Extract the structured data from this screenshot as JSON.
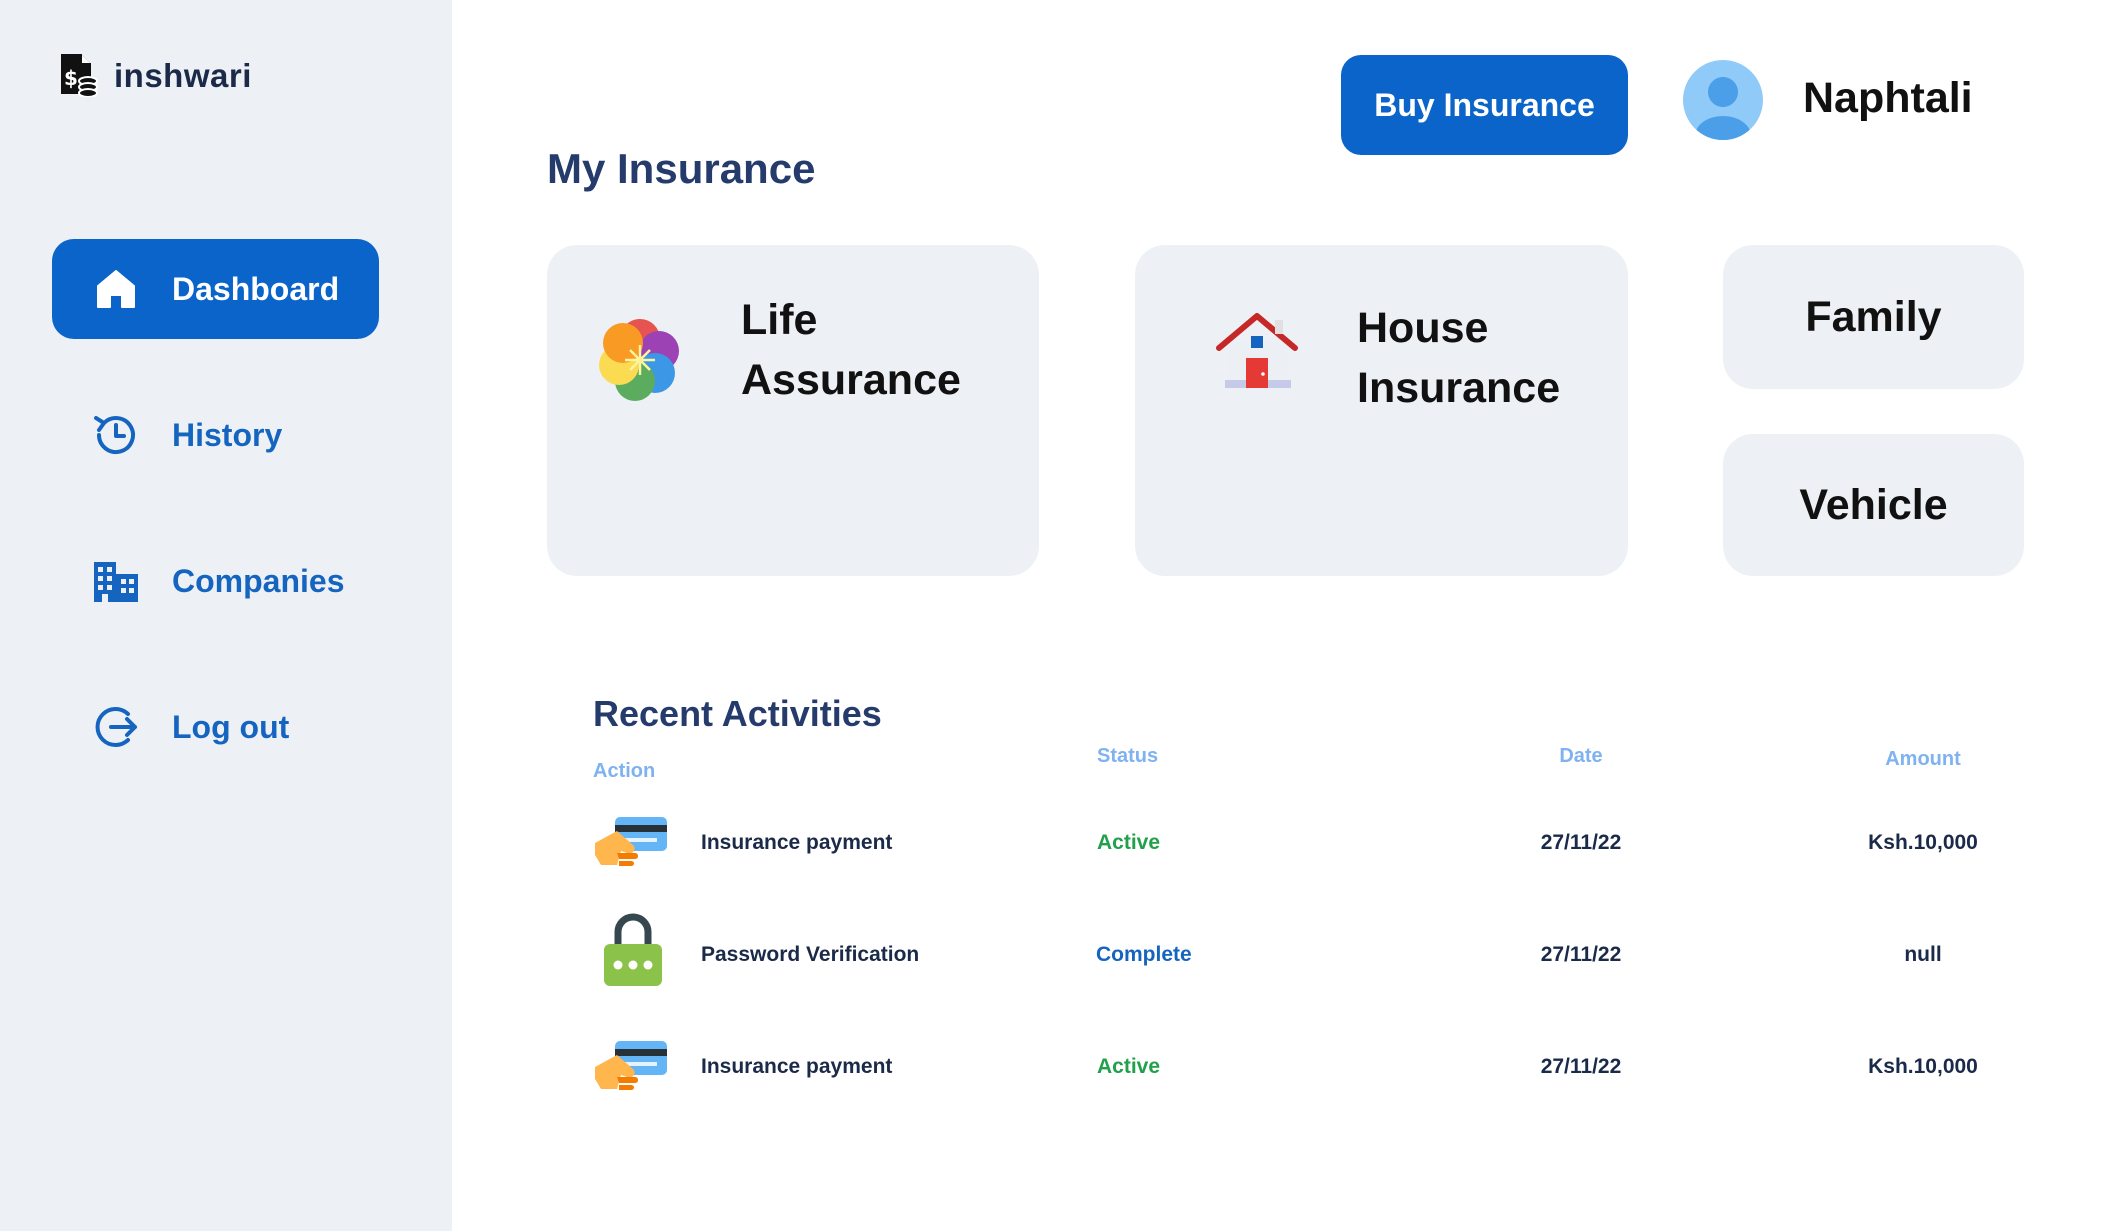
{
  "brand": {
    "name": "inshwari",
    "icon": "money-document-icon"
  },
  "sidebar": {
    "items": [
      {
        "label": "Dashboard",
        "icon": "home-icon",
        "active": true
      },
      {
        "label": "History",
        "icon": "history-icon",
        "active": false
      },
      {
        "label": "Companies",
        "icon": "buildings-icon",
        "active": false
      },
      {
        "label": "Log out",
        "icon": "logout-icon",
        "active": false
      }
    ]
  },
  "header": {
    "buy_label": "Buy Insurance",
    "user_name": "Naphtali",
    "avatar_icon": "user-avatar-icon"
  },
  "main": {
    "title": "My Insurance",
    "cards": [
      {
        "line1": "Life",
        "line2": "Assurance",
        "icon": "flower-icon"
      },
      {
        "line1": "House",
        "line2": "Insurance",
        "icon": "house-icon"
      },
      {
        "label": "Family"
      },
      {
        "label": "Vehicle"
      }
    ]
  },
  "activities": {
    "title": "Recent Activities",
    "headers": {
      "action": "Action",
      "status": "Status",
      "date": "Date",
      "amount": "Amount"
    },
    "rows": [
      {
        "action": "Insurance payment",
        "status": "Active",
        "date": "27/11/22",
        "amount": "Ksh.10,000",
        "icon": "card-payment-icon"
      },
      {
        "action": "Password Verification",
        "status": "Complete",
        "date": "27/11/22",
        "amount": "null",
        "icon": "padlock-icon"
      },
      {
        "action": "Insurance payment",
        "status": "Active",
        "date": "27/11/22",
        "amount": "Ksh.10,000",
        "icon": "card-payment-icon"
      }
    ]
  },
  "colors": {
    "accent": "#0a64c9",
    "sidebar_bg": "#edf1f5",
    "title": "#243b6b",
    "status_active": "#22a04b",
    "status_complete": "#1565c0",
    "column_header": "#7fb2f0"
  }
}
